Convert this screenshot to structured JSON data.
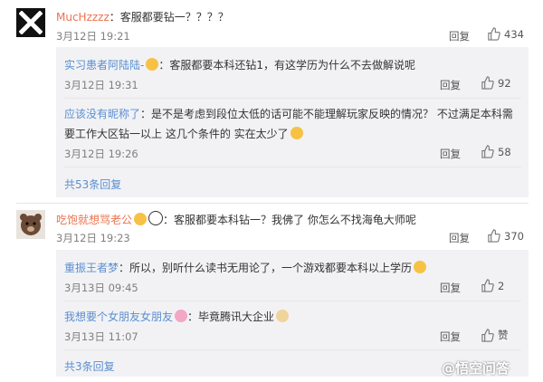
{
  "c1": {
    "username": "MucHzzzz",
    "text": "：客服都要钻一？？？？",
    "time": "3月12日 19:21",
    "reply": "回复",
    "likes": "434",
    "subs": [
      {
        "username": "实习患者阿陆陆-",
        "text": "：客服都要本科还钻1，有这学历为什么不去做解说呢",
        "time": "3月12日 19:31",
        "reply": "回复",
        "likes": "92"
      },
      {
        "username": "应该没有昵称了",
        "text_line1": "：是不是考虑到段位太低的话可能不能理解玩家反映的情况？ 不过满足本科需",
        "text_line2": "要工作大区钻一以上 这几个条件的 实在太少了",
        "time": "3月12日 19:26",
        "reply": "回复",
        "likes": "58"
      }
    ],
    "more": "共53条回复"
  },
  "c2": {
    "username": "吃饱就想骂老公",
    "text": "：客服都要本科钻一？我佛了 你怎么不找海龟大师呢",
    "time": "3月12日 19:23",
    "reply": "回复",
    "likes": "370",
    "subs": [
      {
        "username": "重振王者梦",
        "text": "：所以，别听什么读书无用论了，一个游戏都要本科以上学历",
        "time": "3月13日 09:45",
        "reply": "回复",
        "likes": "2"
      },
      {
        "username": "我想要个女朋友女朋友",
        "text": "：毕竟腾讯大企业",
        "time": "3月13日 11:07",
        "reply": "回复",
        "likes": "赞"
      }
    ],
    "more": "共3条回复"
  },
  "watermark": "@悟空问答"
}
